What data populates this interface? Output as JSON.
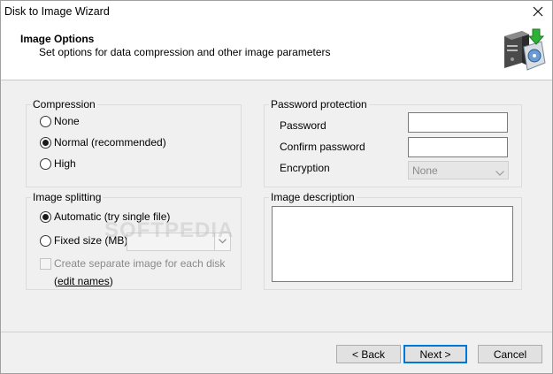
{
  "window": {
    "title": "Disk to Image Wizard"
  },
  "header": {
    "title": "Image Options",
    "subtitle": "Set options for data compression and other image parameters",
    "icon": "disk-to-image-icon"
  },
  "compression": {
    "legend": "Compression",
    "options": [
      {
        "label": "None",
        "checked": false
      },
      {
        "label": "Normal (recommended)",
        "checked": true
      },
      {
        "label": "High",
        "checked": false
      }
    ]
  },
  "image_splitting": {
    "legend": "Image splitting",
    "automatic_label": "Automatic (try single file)",
    "fixed_size_label": "Fixed size (MB)",
    "separate_image_label": "Create separate image for each disk",
    "edit_names_prefix": "(",
    "edit_names_link": "edit names",
    "edit_names_suffix": ")"
  },
  "password_protection": {
    "legend": "Password protection",
    "password_label": "Password",
    "password_value": "",
    "confirm_label": "Confirm password",
    "confirm_value": "",
    "encryption_label": "Encryption",
    "encryption_value": "None"
  },
  "image_description": {
    "legend": "Image description",
    "value": ""
  },
  "watermark": "SOFTPEDIA",
  "buttons": {
    "back": "< Back",
    "next": "Next >",
    "cancel": "Cancel"
  },
  "colors": {
    "dialog_bg": "#f0f0f0",
    "header_bg": "#ffffff",
    "default_button_border": "#0078d7"
  }
}
